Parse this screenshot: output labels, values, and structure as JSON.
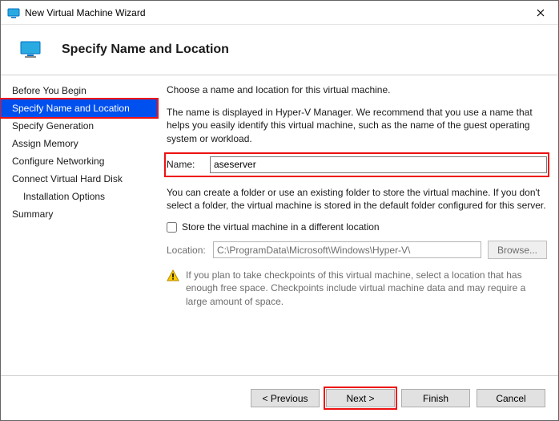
{
  "window": {
    "title": "New Virtual Machine Wizard"
  },
  "header": {
    "title": "Specify Name and Location"
  },
  "sidebar": {
    "items": [
      {
        "label": "Before You Begin"
      },
      {
        "label": "Specify Name and Location"
      },
      {
        "label": "Specify Generation"
      },
      {
        "label": "Assign Memory"
      },
      {
        "label": "Configure Networking"
      },
      {
        "label": "Connect Virtual Hard Disk"
      },
      {
        "label": "Installation Options"
      },
      {
        "label": "Summary"
      }
    ],
    "selected_index": 1
  },
  "content": {
    "intro": "Choose a name and location for this virtual machine.",
    "description": "The name is displayed in Hyper-V Manager. We recommend that you use a name that helps you easily identify this virtual machine, such as the name of the guest operating system or workload.",
    "name_label": "Name:",
    "name_value": "aseserver",
    "folder_text": "You can create a folder or use an existing folder to store the virtual machine. If you don't select a folder, the virtual machine is stored in the default folder configured for this server.",
    "checkbox_label": "Store the virtual machine in a different location",
    "checkbox_checked": false,
    "location_label": "Location:",
    "location_value": "C:\\ProgramData\\Microsoft\\Windows\\Hyper-V\\",
    "browse_label": "Browse...",
    "warning": "If you plan to take checkpoints of this virtual machine, select a location that has enough free space. Checkpoints include virtual machine data and may require a large amount of space."
  },
  "footer": {
    "previous": "< Previous",
    "next": "Next >",
    "finish": "Finish",
    "cancel": "Cancel"
  }
}
